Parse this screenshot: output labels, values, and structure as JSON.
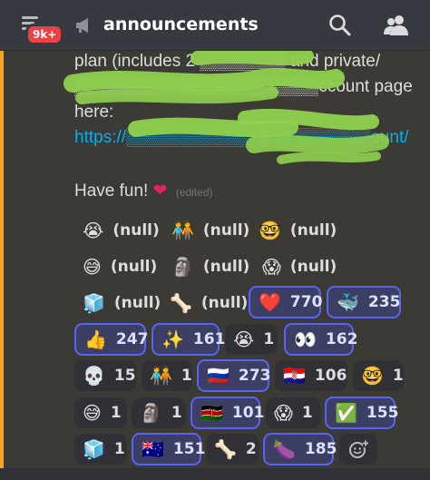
{
  "header": {
    "unread_badge": "9k+",
    "channel_name": "announcements",
    "icons": [
      "hamburger-menu-icon",
      "megaphone-icon",
      "search-icon",
      "members-icon"
    ]
  },
  "message": {
    "line1": "plan (includes 2 ▒▒▒▒▒▒▒ and private/",
    "line2": "▒▒▒▒▒▒▒▒▒▒▒▒▒▒▒▒▒▒▒▒ccount page",
    "line3": "here:",
    "link": "https://▒▒▒▒▒▒▒▒▒▒▒▒▒▒▒▒▒▒▒▒ount/",
    "have_fun": "Have fun!",
    "heart": "❤",
    "edited": "(edited)"
  },
  "reactions": [
    {
      "emoji": "😭",
      "count": "(null)",
      "style": "plain"
    },
    {
      "emoji": "🧑‍🤝‍🧑",
      "count": "(null)",
      "style": "plain"
    },
    {
      "emoji": "🤓",
      "count": "(null)",
      "style": "plain"
    },
    {
      "emoji": "😅",
      "count": "(null)",
      "style": "plain"
    },
    {
      "emoji": "🗿",
      "count": "(null)",
      "style": "plain"
    },
    {
      "emoji": "😱",
      "count": "(null)",
      "style": "plain"
    },
    {
      "emoji": "🧊",
      "count": "(null)",
      "style": "plain"
    },
    {
      "emoji": "🦴",
      "count": "(null)",
      "style": "plain"
    },
    {
      "emoji": "❤️",
      "count": "770",
      "style": "me"
    },
    {
      "emoji": "🐳",
      "count": "235",
      "style": "me"
    },
    {
      "emoji": "👍",
      "count": "247",
      "style": "me"
    },
    {
      "emoji": "✨",
      "count": "161",
      "style": "me"
    },
    {
      "emoji": "😭",
      "count": "1",
      "style": "dark"
    },
    {
      "emoji": "👀",
      "count": "162",
      "style": "me"
    },
    {
      "emoji": "💀",
      "count": "15",
      "style": "dark"
    },
    {
      "emoji": "🧑‍🤝‍🧑",
      "count": "1",
      "style": "dark"
    },
    {
      "emoji": "🇷🇺",
      "count": "273",
      "style": "me"
    },
    {
      "emoji": "🇭🇷",
      "count": "106",
      "style": "dark"
    },
    {
      "emoji": "🤓",
      "count": "1",
      "style": "dark"
    },
    {
      "emoji": "😅",
      "count": "1",
      "style": "dark"
    },
    {
      "emoji": "🗿",
      "count": "1",
      "style": "dark"
    },
    {
      "emoji": "🇰🇪",
      "count": "101",
      "style": "me"
    },
    {
      "emoji": "😱",
      "count": "1",
      "style": "dark"
    },
    {
      "emoji": "✅",
      "count": "155",
      "style": "me"
    },
    {
      "emoji": "🧊",
      "count": "1",
      "style": "dark"
    },
    {
      "emoji": "🇦🇺",
      "count": "151",
      "style": "me"
    },
    {
      "emoji": "🦴",
      "count": "2",
      "style": "dark"
    },
    {
      "emoji": "🍆",
      "count": "185",
      "style": "me"
    }
  ],
  "add_reaction_icon": "add-reaction-icon",
  "colors": {
    "background": "#36393f",
    "accent_bar": "#faa61a",
    "reaction_me_border": "#5865f2",
    "reaction_me_bg": "#3c3f63",
    "link": "#00aff4",
    "badge": "#ed4245",
    "scribble": "#8fd14f"
  }
}
